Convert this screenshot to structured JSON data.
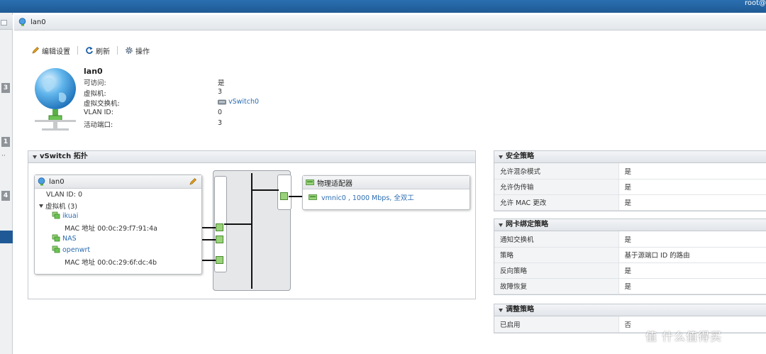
{
  "topbar": {
    "user": "root@"
  },
  "left_rail": {
    "badges": [
      "3",
      "1",
      "4"
    ],
    "dots": "··"
  },
  "header": {
    "title": "lan0"
  },
  "toolbar": {
    "edit": "编辑设置",
    "refresh": "刷新",
    "actions": "操作"
  },
  "summary": {
    "name": "lan0",
    "rows": [
      {
        "label": "可访问:",
        "value": "是"
      },
      {
        "label": "虚拟机:",
        "value": "3"
      },
      {
        "label": "虚拟交换机:",
        "value": "vSwitch0"
      },
      {
        "label": "VLAN ID:",
        "value": "0"
      },
      {
        "label": "活动端口:",
        "value": "3"
      }
    ]
  },
  "topology": {
    "title": "vSwitch 拓扑",
    "portgroup": {
      "name": "lan0",
      "vlan": "VLAN ID: 0",
      "vms_label": "虚拟机 (3)",
      "vms": [
        {
          "name": "ikuai",
          "mac": "MAC 地址 00:0c:29:f7:91:4a"
        },
        {
          "name": "NAS",
          "mac": ""
        },
        {
          "name": "openwrt",
          "mac": "MAC 地址 00:0c:29:6f:dc:4b"
        }
      ]
    },
    "adapters": {
      "title": "物理适配器",
      "nic": "vmnic0 , 1000 Mbps, 全双工"
    }
  },
  "security": {
    "title": "安全策略",
    "rows": [
      {
        "k": "允许混杂模式",
        "v": "是"
      },
      {
        "k": "允许伪传输",
        "v": "是"
      },
      {
        "k": "允许 MAC 更改",
        "v": "是"
      }
    ]
  },
  "teaming": {
    "title": "网卡绑定策略",
    "rows": [
      {
        "k": "通知交换机",
        "v": "是"
      },
      {
        "k": "策略",
        "v": "基于源端口 ID 的路由"
      },
      {
        "k": "反向策略",
        "v": "是"
      },
      {
        "k": "故障恢复",
        "v": "是"
      }
    ]
  },
  "shaping": {
    "title": "调整策略",
    "rows": [
      {
        "k": "已启用",
        "v": "否"
      }
    ]
  },
  "watermark": "值 什么值得买",
  "colors": {
    "accent": "#1f5a96",
    "link": "#2b6cb0",
    "port": "#9ad27a"
  }
}
